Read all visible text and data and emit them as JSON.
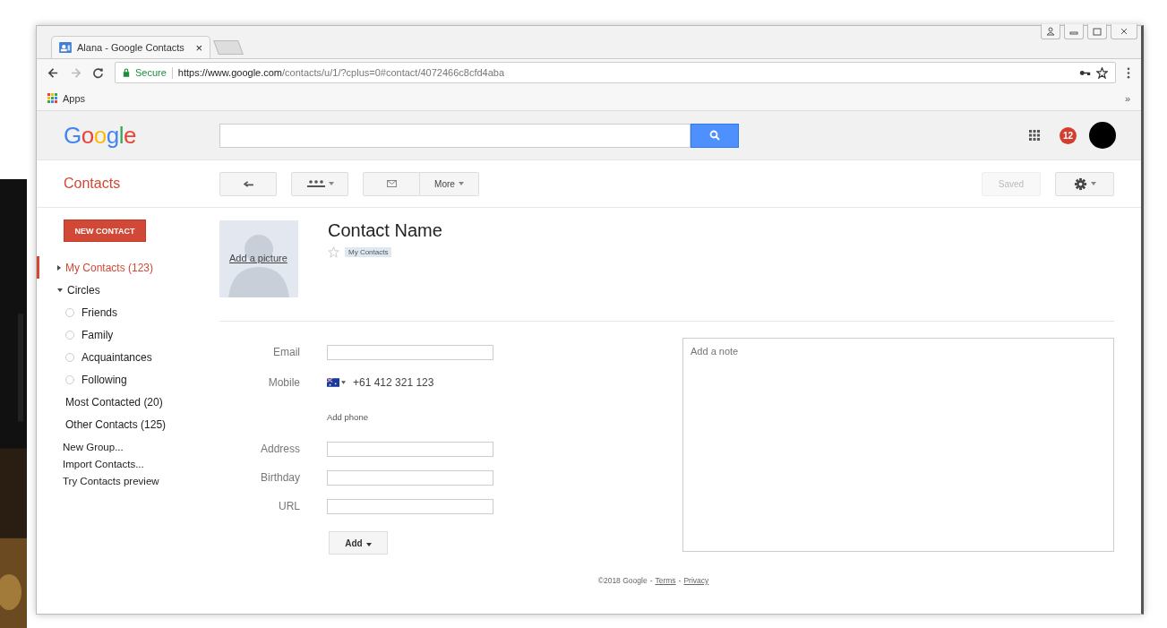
{
  "browser": {
    "tab_title": "Alana - Google Contacts",
    "close": "×",
    "secure_label": "Secure",
    "url_host": "https://www.google.com",
    "url_path": "/contacts/u/1/?cplus=0#contact/4072466c8cfd4aba",
    "bookmarks": [
      {
        "label": "Apps"
      }
    ],
    "overflow": "»"
  },
  "header": {
    "logo": "Google",
    "notifications": "12"
  },
  "toolbar": {
    "app_title": "Contacts",
    "more": "More",
    "saved": {
      "label": "Saved",
      "disabled": true
    }
  },
  "sidebar": {
    "new_contact": "NEW CONTACT",
    "items": [
      {
        "label": "My Contacts (123)",
        "selected": true,
        "expanded": false,
        "collapsible": true
      },
      {
        "label": "Circles",
        "selected": false,
        "expanded": true,
        "collapsible": true,
        "children": [
          {
            "label": "Friends",
            "selected": false
          },
          {
            "label": "Family",
            "selected": false
          },
          {
            "label": "Acquaintances",
            "selected": false
          },
          {
            "label": "Following",
            "selected": false
          }
        ]
      },
      {
        "label": "Most Contacted (20)",
        "selected": false
      },
      {
        "label": "Other Contacts (125)",
        "selected": false
      }
    ],
    "links": [
      "New Group...",
      "Import Contacts...",
      "Try Contacts preview"
    ]
  },
  "contact": {
    "add_picture": "Add a picture",
    "name": "Contact Name",
    "starred": false,
    "group_tag": "My Contacts",
    "fields": [
      {
        "kind": "input",
        "label": "Email"
      },
      {
        "kind": "phone",
        "label": "Mobile",
        "value": "+61 412 321 123"
      },
      {
        "kind": "link",
        "value": "Add phone"
      },
      {
        "kind": "input",
        "label": "Address"
      },
      {
        "kind": "input",
        "label": "Birthday"
      },
      {
        "kind": "input",
        "label": "URL"
      }
    ],
    "add_button": "Add",
    "note": {
      "placeholder": "Add a note"
    }
  },
  "footer": [
    {
      "kind": "text",
      "text": "©2018 Google"
    },
    {
      "kind": "separator",
      "text": "-"
    },
    {
      "kind": "link",
      "text": "Terms"
    },
    {
      "kind": "separator",
      "text": "-"
    },
    {
      "kind": "link",
      "text": "Privacy"
    }
  ]
}
